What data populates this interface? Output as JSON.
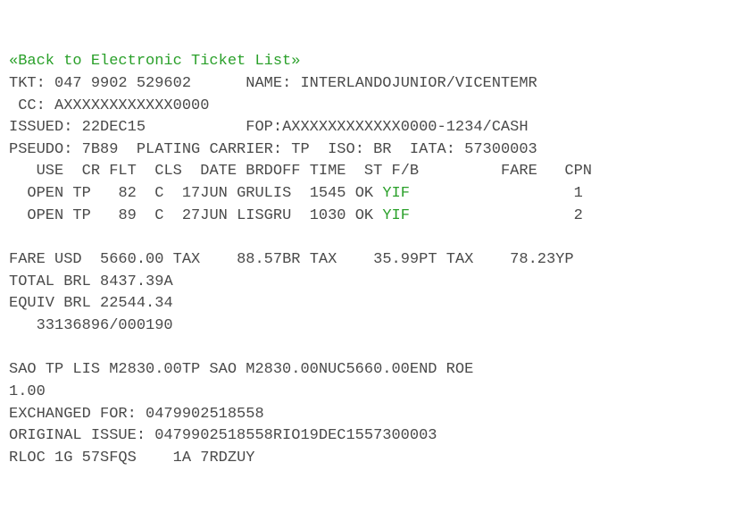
{
  "back_link": "«Back to Electronic Ticket List»",
  "header": {
    "tkt_label": "TKT:",
    "tkt": "047 9902 529602",
    "name_label": "NAME:",
    "name": "INTERLANDOJUNIOR/VICENTEMR",
    "cc_label": "CC:",
    "cc": "AXXXXXXXXXXXX0000",
    "issued_label": "ISSUED:",
    "issued": "22DEC15",
    "fop_label": "FOP:",
    "fop": "AXXXXXXXXXXXX0000-1234/CASH",
    "pseudo_label": "PSEUDO:",
    "pseudo": "7B89",
    "plating_label": "PLATING CARRIER:",
    "plating": "TP",
    "iso_label": "ISO:",
    "iso": "BR",
    "iata_label": "IATA:",
    "iata": "57300003"
  },
  "cols": {
    "use": "USE",
    "cr": "CR",
    "flt": "FLT",
    "cls": "CLS",
    "date": "DATE",
    "brdoff": "BRDOFF",
    "time": "TIME",
    "st": "ST",
    "fb": "F/B",
    "fare": "FARE",
    "cpn": "CPN"
  },
  "segments": [
    {
      "use": "OPEN",
      "cr": "TP",
      "flt": "82",
      "cls": "C",
      "date": "17JUN",
      "brdoff": "GRULIS",
      "time": "1545",
      "st": "OK",
      "fb": "YIF",
      "cpn": "1"
    },
    {
      "use": "OPEN",
      "cr": "TP",
      "flt": "89",
      "cls": "C",
      "date": "27JUN",
      "brdoff": "LISGRU",
      "time": "1030",
      "st": "OK",
      "fb": "YIF",
      "cpn": "2"
    }
  ],
  "fare": {
    "fare_label": "FARE USD",
    "fare_amt": "5660.00",
    "tax_label": "TAX",
    "tax1": "88.57BR",
    "tax2": "35.99PT",
    "tax3": "78.23YP",
    "total_label": "TOTAL BRL",
    "total": "8437.39A",
    "equiv_label": "EQUIV BRL",
    "equiv": "22544.34",
    "ref": "33136896/000190"
  },
  "calc": {
    "line1": "SAO TP LIS M2830.00TP SAO M2830.00NUC5660.00END ROE",
    "line2": "1.00"
  },
  "exchange": {
    "exch_label": "EXCHANGED FOR:",
    "exch": "0479902518558",
    "orig_label": "ORIGINAL ISSUE:",
    "orig": "0479902518558RIO19DEC1557300003"
  },
  "rloc": {
    "label": "RLOC",
    "sys1": "1G",
    "code1": "57SFQS",
    "sys2": "1A",
    "code2": "7RDZUY"
  }
}
